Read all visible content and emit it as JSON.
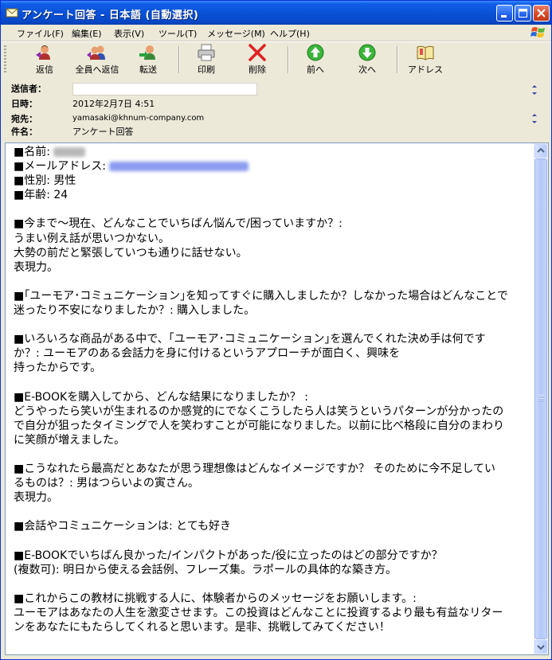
{
  "window": {
    "title": "アンケート回答 - 日本語 (自動選択)"
  },
  "menu": [
    "ファイル(F)",
    "編集(E)",
    "表示(V)",
    "ツール(T)",
    "メッセージ(M)",
    "ヘルプ(H)"
  ],
  "toolbar": {
    "reply": "返信",
    "reply_all": "全員へ返信",
    "forward": "転送",
    "print": "印刷",
    "delete": "削除",
    "previous": "前へ",
    "next": "次へ",
    "address": "アドレス"
  },
  "header": {
    "from_label": "送信者：",
    "from_value": "",
    "date_label": "日時：",
    "date_value": "2012年2月7日 4:51",
    "to_label": "宛先：",
    "to_value": "yamasaki@khnum-company.com",
    "subject_label": "件名：",
    "subject_value": "アンケート回答"
  },
  "message": {
    "name_label": "■名前:",
    "email_label": "■メールアドレス:",
    "gender": "■性別: 男性",
    "age": "■年齢: 24",
    "q1": "■今まで～現在、どんなことでいちばん悩んで/困っていますか？:",
    "a1_l1": "うまい例え話が思いつかない。",
    "a1_l2": "大勢の前だと緊張していつも通りに話せない。",
    "a1_l3": "表現力。",
    "q2_l1": "■｢ユーモア･コミュニケーション｣を知ってすぐに購入しましたか？しなかった場合はどんなことで",
    "q2_l2": "迷ったり不安になりましたか？: 購入しました。",
    "q3_l1": "■いろいろな商品がある中で、｢ユーモア･コミュニケーション｣を選んでくれた決め手は何です",
    "q3_l2": "か？: ユーモアのある会話力を身に付けるというアプローチが面白く、興味を",
    "q3_l3": "持ったからです。",
    "q4": "■E-BOOKを購入してから、どんな結果になりましたか？ :",
    "a4_l1": "どうやったら笑いが生まれるのか感覚的にでなくこうしたら人は笑うというパターンが分かったの",
    "a4_l2": "で自分が狙ったタイミングで人を笑わすことが可能になりました。以前に比べ格段に自分のまわり",
    "a4_l3": "に笑顔が増えました。",
    "q5_l1": "■こうなれたら最高だとあなたが思う理想像はどんなイメージですか？ そのために今不足してい",
    "q5_l2": "るものは？: 男はつらいよの寅さん。",
    "a5_l3": "表現力。",
    "q6": "■会話やコミュニケーションは: とても好き",
    "q7_l1": "■E-BOOKでいちばん良かった/インパクトがあった/役に立ったのはどの部分ですか？",
    "q7_l2": "(複数可): 明日から使える会話例、フレーズ集。ラポールの具体的な築き方。",
    "q8": "■これからこの教材に挑戦する人に、体験者からのメッセージをお願いします。:",
    "a8_l1": "ユーモアはあなたの人生を激変させます。この投資はどんなことに投資するより最も有益なリター",
    "a8_l2": "ンをあなたにもたらしてくれると思います。是非、挑戦してみてください！"
  }
}
